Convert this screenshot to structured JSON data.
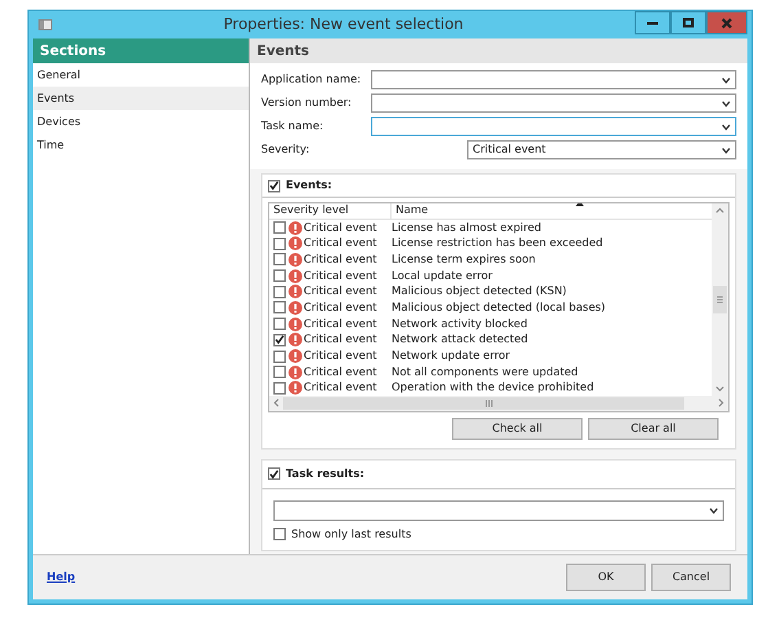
{
  "window": {
    "title": "Properties: New event selection"
  },
  "sidebar": {
    "title": "Sections",
    "items": [
      {
        "label": "General",
        "selected": false
      },
      {
        "label": "Events",
        "selected": true
      },
      {
        "label": "Devices",
        "selected": false
      },
      {
        "label": "Time",
        "selected": false
      }
    ]
  },
  "panel": {
    "title": "Events",
    "fields": [
      {
        "label": "Application name:"
      },
      {
        "label": "Version number:"
      },
      {
        "label": "Task name:"
      },
      {
        "label": "Severity:",
        "value": "Critical event"
      }
    ]
  },
  "events": {
    "label": "Events:",
    "checked": true,
    "columns": [
      "Severity level",
      "Name"
    ],
    "rows": [
      {
        "severity": "Critical event",
        "name": "License has almost expired",
        "checked": false
      },
      {
        "severity": "Critical event",
        "name": "License restriction has been exceeded",
        "checked": false
      },
      {
        "severity": "Critical event",
        "name": "License term expires soon",
        "checked": false
      },
      {
        "severity": "Critical event",
        "name": "Local update error",
        "checked": false
      },
      {
        "severity": "Critical event",
        "name": "Malicious object detected (KSN)",
        "checked": false
      },
      {
        "severity": "Critical event",
        "name": "Malicious object detected (local bases)",
        "checked": false
      },
      {
        "severity": "Critical event",
        "name": "Network activity blocked",
        "checked": false
      },
      {
        "severity": "Critical event",
        "name": "Network attack detected",
        "checked": true
      },
      {
        "severity": "Critical event",
        "name": "Network update error",
        "checked": false
      },
      {
        "severity": "Critical event",
        "name": "Not all components were updated",
        "checked": false
      },
      {
        "severity": "Critical event",
        "name": "Operation with the device prohibited",
        "checked": false
      }
    ],
    "buttons": [
      "Check all",
      "Clear all"
    ]
  },
  "task_results": {
    "label": "Task results:",
    "checked": true,
    "option": {
      "label": "Show only last results",
      "checked": false
    }
  },
  "footer": {
    "help": "Help",
    "buttons": [
      "OK",
      "Cancel"
    ]
  }
}
